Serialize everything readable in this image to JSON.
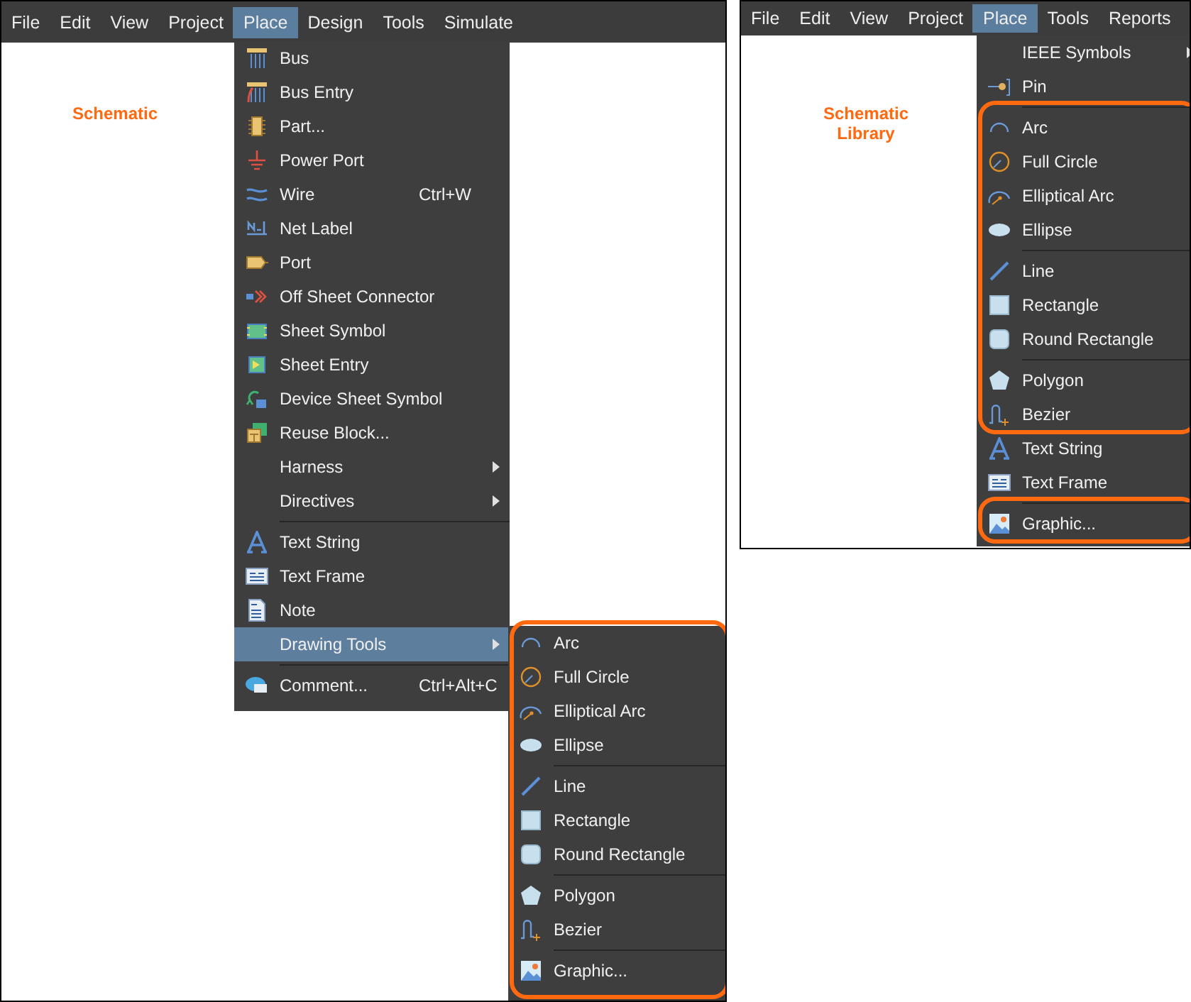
{
  "windows": [
    {
      "kind": "schematic",
      "menubar": [
        {
          "label": "File",
          "selected": false
        },
        {
          "label": "Edit",
          "selected": false
        },
        {
          "label": "View",
          "selected": false
        },
        {
          "label": "Project",
          "selected": false
        },
        {
          "label": "Place",
          "selected": true
        },
        {
          "label": "Design",
          "selected": false
        },
        {
          "label": "Tools",
          "selected": false
        },
        {
          "label": "Simulate",
          "selected": false
        }
      ],
      "canvas_label": "Schematic",
      "menu": {
        "groups": [
          {
            "highlighted": false,
            "items": [
              {
                "label": "Bus",
                "kind": "bus",
                "selected": false,
                "submenu": false,
                "separator_before": false
              },
              {
                "label": "Bus Entry",
                "kind": "bus_entry",
                "selected": false,
                "submenu": false,
                "separator_before": false
              },
              {
                "label": "Part...",
                "kind": "part",
                "selected": false,
                "submenu": false,
                "separator_before": false
              },
              {
                "label": "Power Port",
                "kind": "power_port",
                "selected": false,
                "submenu": false,
                "separator_before": false
              },
              {
                "label": "Wire",
                "kind": "wire",
                "selected": false,
                "submenu": false,
                "separator_before": false,
                "shortcut": "Ctrl+W"
              },
              {
                "label": "Net Label",
                "kind": "net_label",
                "selected": false,
                "submenu": false,
                "separator_before": false
              },
              {
                "label": "Port",
                "kind": "port",
                "selected": false,
                "submenu": false,
                "separator_before": false
              },
              {
                "label": "Off Sheet Connector",
                "kind": "off_sheet",
                "selected": false,
                "submenu": false,
                "separator_before": false
              },
              {
                "label": "Sheet Symbol",
                "kind": "sheet_symbol",
                "selected": false,
                "submenu": false,
                "separator_before": false
              },
              {
                "label": "Sheet Entry",
                "kind": "sheet_entry",
                "selected": false,
                "submenu": false,
                "separator_before": false
              },
              {
                "label": "Device Sheet Symbol",
                "kind": "device_sheet",
                "selected": false,
                "submenu": false,
                "separator_before": false
              },
              {
                "label": "Reuse Block...",
                "kind": "reuse_block",
                "selected": false,
                "submenu": false,
                "separator_before": false
              },
              {
                "label": "Harness",
                "kind": "plain",
                "selected": false,
                "submenu": true,
                "separator_before": false
              },
              {
                "label": "Directives",
                "kind": "plain",
                "selected": false,
                "submenu": true,
                "separator_before": false
              },
              {
                "label": "Text String",
                "kind": "text_string",
                "selected": false,
                "submenu": false,
                "separator_before": true
              },
              {
                "label": "Text Frame",
                "kind": "text_frame",
                "selected": false,
                "submenu": false,
                "separator_before": false
              },
              {
                "label": "Note",
                "kind": "note",
                "selected": false,
                "submenu": false,
                "separator_before": false
              },
              {
                "label": "Drawing Tools",
                "kind": "plain",
                "selected": true,
                "submenu": true,
                "separator_before": false
              },
              {
                "label": "Comment...",
                "kind": "comment",
                "selected": false,
                "submenu": false,
                "separator_before": true,
                "shortcut": "Ctrl+Alt+C"
              }
            ]
          }
        ]
      },
      "submenu": {
        "groups": [
          {
            "highlighted": true,
            "items": [
              {
                "label": "Arc",
                "kind": "arc",
                "selected": false,
                "submenu": false,
                "separator_before": false
              },
              {
                "label": "Full Circle",
                "kind": "full_circle",
                "selected": false,
                "submenu": false,
                "separator_before": false
              },
              {
                "label": "Elliptical Arc",
                "kind": "elliptical_arc",
                "selected": false,
                "submenu": false,
                "separator_before": false
              },
              {
                "label": "Ellipse",
                "kind": "ellipse",
                "selected": false,
                "submenu": false,
                "separator_before": false
              },
              {
                "label": "Line",
                "kind": "line",
                "selected": false,
                "submenu": false,
                "separator_before": true
              },
              {
                "label": "Rectangle",
                "kind": "rectangle",
                "selected": false,
                "submenu": false,
                "separator_before": false
              },
              {
                "label": "Round Rectangle",
                "kind": "round_rectangle",
                "selected": false,
                "submenu": false,
                "separator_before": false
              },
              {
                "label": "Polygon",
                "kind": "polygon",
                "selected": false,
                "submenu": false,
                "separator_before": true
              },
              {
                "label": "Bezier",
                "kind": "bezier",
                "selected": false,
                "submenu": false,
                "separator_before": false
              },
              {
                "label": "Graphic...",
                "kind": "graphic",
                "selected": false,
                "submenu": false,
                "separator_before": true
              }
            ]
          }
        ]
      }
    },
    {
      "kind": "library",
      "menubar": [
        {
          "label": "File",
          "selected": false
        },
        {
          "label": "Edit",
          "selected": false
        },
        {
          "label": "View",
          "selected": false
        },
        {
          "label": "Project",
          "selected": false
        },
        {
          "label": "Place",
          "selected": true
        },
        {
          "label": "Tools",
          "selected": false
        },
        {
          "label": "Reports",
          "selected": false
        }
      ],
      "canvas_label": "Schematic Library",
      "menu": {
        "groups": [
          {
            "highlighted": false,
            "items": [
              {
                "label": "IEEE Symbols",
                "kind": "plain",
                "selected": false,
                "submenu": true,
                "separator_before": false
              },
              {
                "label": "Pin",
                "kind": "pin",
                "selected": false,
                "submenu": false,
                "separator_before": false
              }
            ]
          },
          {
            "highlighted": true,
            "items": [
              {
                "label": "Arc",
                "kind": "arc",
                "selected": false,
                "submenu": false,
                "separator_before": true
              },
              {
                "label": "Full Circle",
                "kind": "full_circle",
                "selected": false,
                "submenu": false,
                "separator_before": false
              },
              {
                "label": "Elliptical Arc",
                "kind": "elliptical_arc",
                "selected": false,
                "submenu": false,
                "separator_before": false
              },
              {
                "label": "Ellipse",
                "kind": "ellipse",
                "selected": false,
                "submenu": false,
                "separator_before": false
              },
              {
                "label": "Line",
                "kind": "line",
                "selected": false,
                "submenu": false,
                "separator_before": true
              },
              {
                "label": "Rectangle",
                "kind": "rectangle",
                "selected": false,
                "submenu": false,
                "separator_before": false
              },
              {
                "label": "Round Rectangle",
                "kind": "round_rectangle",
                "selected": false,
                "submenu": false,
                "separator_before": false
              },
              {
                "label": "Polygon",
                "kind": "polygon",
                "selected": false,
                "submenu": false,
                "separator_before": true
              },
              {
                "label": "Bezier",
                "kind": "bezier",
                "selected": false,
                "submenu": false,
                "separator_before": false
              }
            ]
          },
          {
            "highlighted": false,
            "items": [
              {
                "label": "Text String",
                "kind": "text_string",
                "selected": false,
                "submenu": false,
                "separator_before": false
              },
              {
                "label": "Text Frame",
                "kind": "text_frame",
                "selected": false,
                "submenu": false,
                "separator_before": false
              }
            ]
          },
          {
            "highlighted": true,
            "items": [
              {
                "label": "Graphic...",
                "kind": "graphic",
                "selected": false,
                "submenu": false,
                "separator_before": true
              }
            ]
          }
        ]
      }
    }
  ]
}
